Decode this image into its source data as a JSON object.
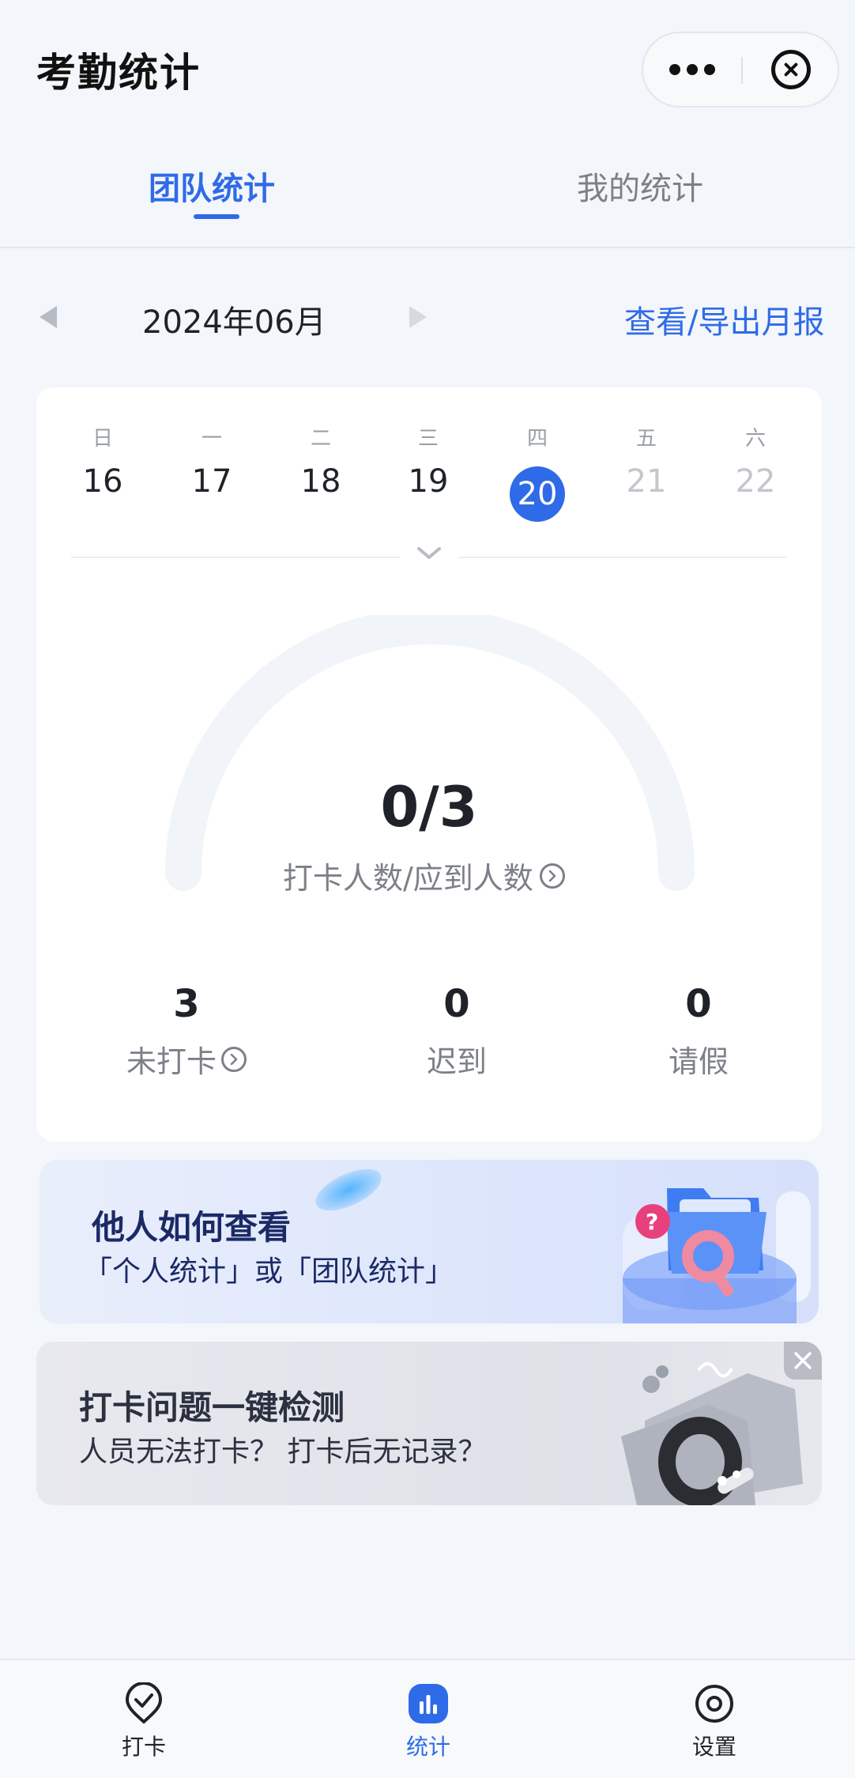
{
  "header": {
    "title": "考勤统计"
  },
  "tabs": [
    {
      "label": "团队统计",
      "active": true
    },
    {
      "label": "我的统计",
      "active": false
    }
  ],
  "month": {
    "label": "2024年06月",
    "export_link": "查看/导出月报"
  },
  "week": {
    "days": [
      "日",
      "一",
      "二",
      "三",
      "四",
      "五",
      "六"
    ],
    "dates": [
      "16",
      "17",
      "18",
      "19",
      "20",
      "21",
      "22"
    ],
    "selected_index": 4
  },
  "gauge": {
    "value": "0/3",
    "label": "打卡人数/应到人数",
    "checked_in": 0,
    "expected": 3
  },
  "stats": [
    {
      "value": "3",
      "label": "未打卡"
    },
    {
      "value": "0",
      "label": "迟到"
    },
    {
      "value": "0",
      "label": "请假"
    }
  ],
  "banners": [
    {
      "title": "他人如何查看",
      "subtitle": "「个人统计」或「团队统计」"
    },
    {
      "title": "打卡问题一键检测",
      "subtitle": "人员无法打卡？ 打卡后无记录？"
    }
  ],
  "bottom_nav": [
    {
      "label": "打卡",
      "icon": "check-pin-icon",
      "active": false
    },
    {
      "label": "统计",
      "icon": "bar-chart-icon",
      "active": true
    },
    {
      "label": "设置",
      "icon": "settings-icon",
      "active": false
    }
  ],
  "colors": {
    "accent": "#2f6be8",
    "background": "#f3f6fa",
    "muted": "#7d8088"
  }
}
